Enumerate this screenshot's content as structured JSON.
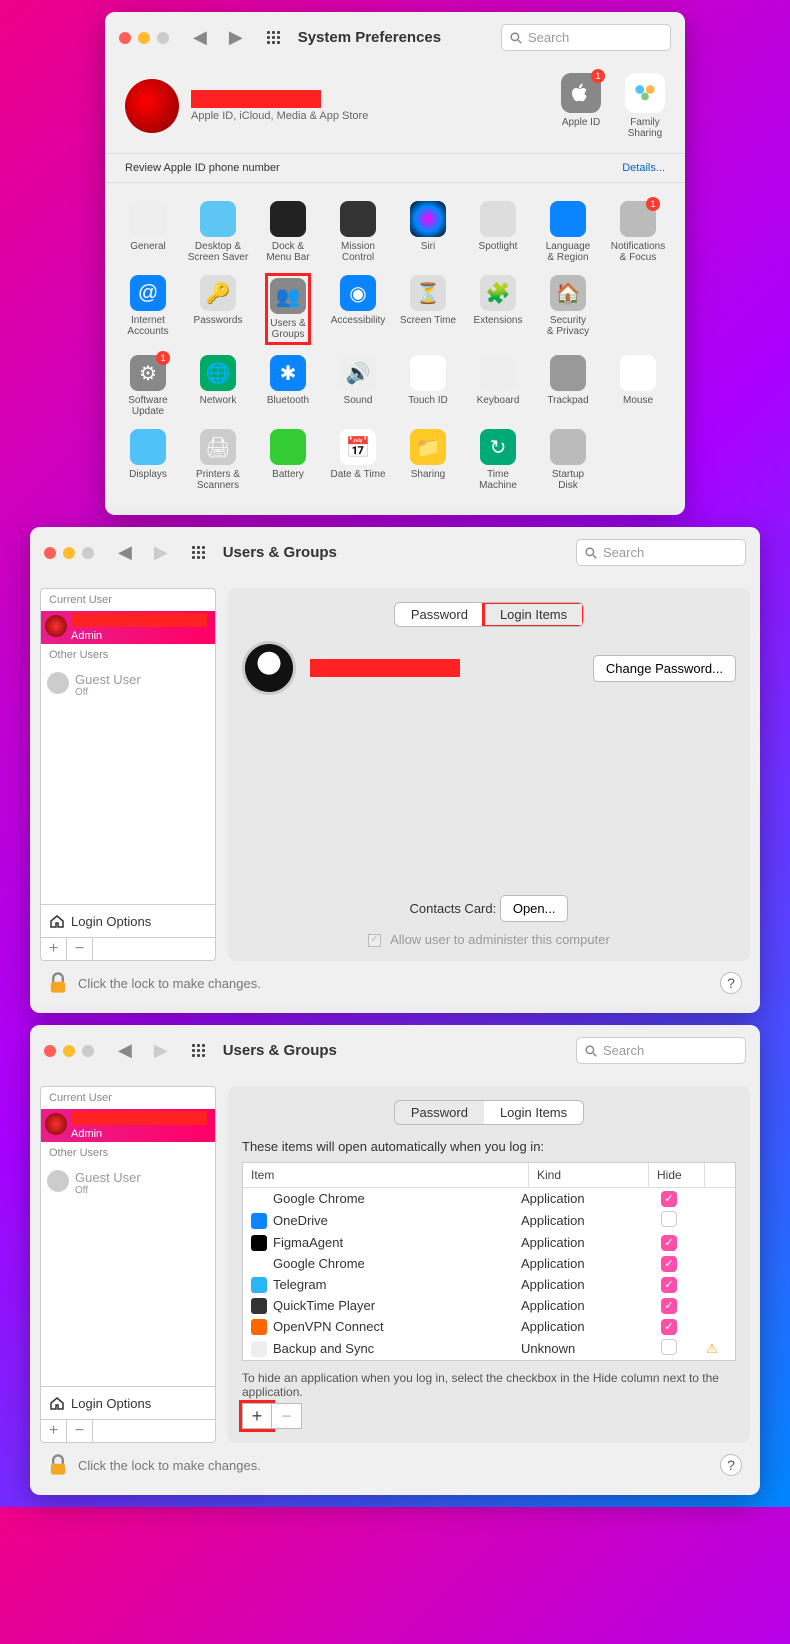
{
  "panel1": {
    "title": "System Preferences",
    "search_placeholder": "Search",
    "profile_sub": "Apple ID, iCloud, Media & App Store",
    "right": [
      {
        "label": "Apple ID",
        "badge": "1"
      },
      {
        "label": "Family\nSharing"
      }
    ],
    "banner_text": "Review Apple ID phone number",
    "banner_link": "Details...",
    "rows": [
      [
        {
          "label": "General",
          "bg": "#eee"
        },
        {
          "label": "Desktop &\nScreen Saver",
          "bg": "#5ec6f2"
        },
        {
          "label": "Dock &\nMenu Bar",
          "bg": "#222"
        },
        {
          "label": "Mission\nControl",
          "bg": "#333"
        },
        {
          "label": "Siri",
          "bg": "radial-gradient(circle,#f0f,#08f,#000)"
        },
        {
          "label": "Spotlight",
          "bg": "#ddd"
        },
        {
          "label": "Language\n& Region",
          "bg": "#0a84ff"
        },
        {
          "label": "Notifications\n& Focus",
          "bg": "#bbb",
          "badge": true
        }
      ],
      [
        {
          "label": "Internet\nAccounts",
          "bg": "#0a84ff",
          "glyph": "@"
        },
        {
          "label": "Passwords",
          "bg": "#ddd",
          "glyph": "🔑"
        },
        {
          "label": "Users &\nGroups",
          "bg": "#888",
          "glyph": "👥",
          "highlight": true
        },
        {
          "label": "Accessibility",
          "bg": "#0a84ff",
          "glyph": "◉"
        },
        {
          "label": "Screen Time",
          "bg": "#ddd",
          "glyph": "⏳"
        },
        {
          "label": "Extensions",
          "bg": "#ddd",
          "glyph": "🧩"
        },
        {
          "label": "Security\n& Privacy",
          "bg": "#bbb",
          "glyph": "🏠"
        }
      ],
      [
        {
          "label": "Software\nUpdate",
          "bg": "#888",
          "glyph": "⚙",
          "badge": true
        },
        {
          "label": "Network",
          "bg": "#0a6",
          "glyph": "🌐"
        },
        {
          "label": "Bluetooth",
          "bg": "#0a84ff",
          "glyph": "✱"
        },
        {
          "label": "Sound",
          "bg": "#eee",
          "glyph": "🔊"
        },
        {
          "label": "Touch ID",
          "bg": "#fff",
          "glyph": "◉"
        },
        {
          "label": "Keyboard",
          "bg": "#eee"
        },
        {
          "label": "Trackpad",
          "bg": "#999"
        },
        {
          "label": "Mouse",
          "bg": "#fff"
        }
      ],
      [
        {
          "label": "Displays",
          "bg": "#4fc3f7"
        },
        {
          "label": "Printers &\nScanners",
          "bg": "#ccc",
          "glyph": "🖨"
        },
        {
          "label": "Battery",
          "bg": "#3c3"
        },
        {
          "label": "Date & Time",
          "bg": "#fff",
          "glyph": "📅"
        },
        {
          "label": "Sharing",
          "bg": "#ffca28",
          "glyph": "📁"
        },
        {
          "label": "Time\nMachine",
          "bg": "#0a7",
          "glyph": "↻"
        },
        {
          "label": "Startup\nDisk",
          "bg": "#bbb"
        }
      ]
    ]
  },
  "panel2": {
    "title": "Users & Groups",
    "search_placeholder": "Search",
    "sidebar": {
      "current_label": "Current User",
      "admin_label": "Admin",
      "other_label": "Other Users",
      "guest_name": "Guest User",
      "guest_status": "Off",
      "login_options": "Login Options"
    },
    "tabs": {
      "password": "Password",
      "login_items": "Login Items"
    },
    "change_password": "Change Password...",
    "contacts_label": "Contacts Card:",
    "open_btn": "Open...",
    "admin_check": "Allow user to administer this computer",
    "lock_text": "Click the lock to make changes."
  },
  "panel3": {
    "title": "Users & Groups",
    "search_placeholder": "Search",
    "sidebar": {
      "current_label": "Current User",
      "admin_label": "Admin",
      "other_label": "Other Users",
      "guest_name": "Guest User",
      "guest_status": "Off",
      "login_options": "Login Options"
    },
    "tabs": {
      "password": "Password",
      "login_items": "Login Items"
    },
    "description": "These items will open automatically when you log in:",
    "columns": {
      "item": "Item",
      "kind": "Kind",
      "hide": "Hide"
    },
    "items": [
      {
        "name": "Google Chrome",
        "kind": "Application",
        "hide": true,
        "color": "#fff"
      },
      {
        "name": "OneDrive",
        "kind": "Application",
        "hide": false,
        "color": "#0a84ff"
      },
      {
        "name": "FigmaAgent",
        "kind": "Application",
        "hide": true,
        "color": "#000"
      },
      {
        "name": "Google Chrome",
        "kind": "Application",
        "hide": true,
        "color": "#fff"
      },
      {
        "name": "Telegram",
        "kind": "Application",
        "hide": true,
        "color": "#29b6f6"
      },
      {
        "name": "QuickTime Player",
        "kind": "Application",
        "hide": true,
        "color": "#333"
      },
      {
        "name": "OpenVPN Connect",
        "kind": "Application",
        "hide": true,
        "color": "#f60"
      },
      {
        "name": "Backup and Sync",
        "kind": "Unknown",
        "hide": false,
        "warn": true,
        "color": "#eee"
      }
    ],
    "hint": "To hide an application when you log in, select the checkbox in the Hide column next to the application.",
    "lock_text": "Click the lock to make changes."
  }
}
